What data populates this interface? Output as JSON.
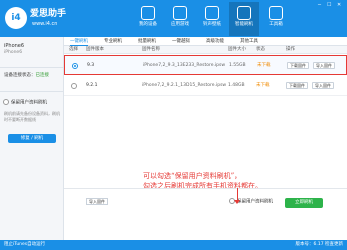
{
  "app": {
    "brand": "爱思助手",
    "url": "www.i4.cn",
    "logo_text": "i4"
  },
  "nav": [
    {
      "label": "我的设备"
    },
    {
      "label": "应用游戏"
    },
    {
      "label": "铃声壁纸"
    },
    {
      "label": "智能刷机"
    },
    {
      "label": "工具箱"
    }
  ],
  "window_controls": [
    "─",
    "☐",
    "✕"
  ],
  "sidebar": {
    "device_name": "iPhone6",
    "device_sub": "iPhone6",
    "connect_label": "设备连接状态：",
    "connect_value": "已连接",
    "option_label": "保留用户资料刷机",
    "description": "刷机前请先备份设备资料，刷机时不要断开数据线",
    "repair_button": "修复 / 刷机"
  },
  "tabs": [
    {
      "label": "一键刷机"
    },
    {
      "label": "专业刷机"
    },
    {
      "label": "批量刷机"
    },
    {
      "label": "一键越狱"
    },
    {
      "label": "高级功能"
    },
    {
      "label": "其他工具"
    }
  ],
  "table": {
    "headers": [
      "选择",
      "固件版本",
      "固件名称",
      "固件大小",
      "状态",
      "操作"
    ],
    "rows": [
      {
        "version": "9.3",
        "name": "iPhone7,2_9.3_13E233_Restore.ipsw",
        "size": "1.55GB",
        "status": "未下载",
        "download": "下载固件",
        "import": "导入固件"
      },
      {
        "version": "9.2.1",
        "name": "iPhone7,2_9.2.1_13D15_Restore.ipsw",
        "size": "1.48GB",
        "status": "未下载",
        "download": "下载固件",
        "import": "导入固件"
      }
    ]
  },
  "annotation": {
    "line1": "可以勾选“保留用户资料刷机”，",
    "line2": "勾选之后刷机完成所有手机资料都在。"
  },
  "bottom": {
    "import_button": "导入固件",
    "keep_data_label": "保留用户资料刷机",
    "flash_button": "立即刷机"
  },
  "statusbar": {
    "left": "阻止iTunes自动运行",
    "right": "版本号：6.17    检查更新"
  },
  "colors": {
    "primary": "#1a8fe6",
    "success": "#2db34a",
    "warning": "#f08a00",
    "annotation": "#e53935"
  }
}
